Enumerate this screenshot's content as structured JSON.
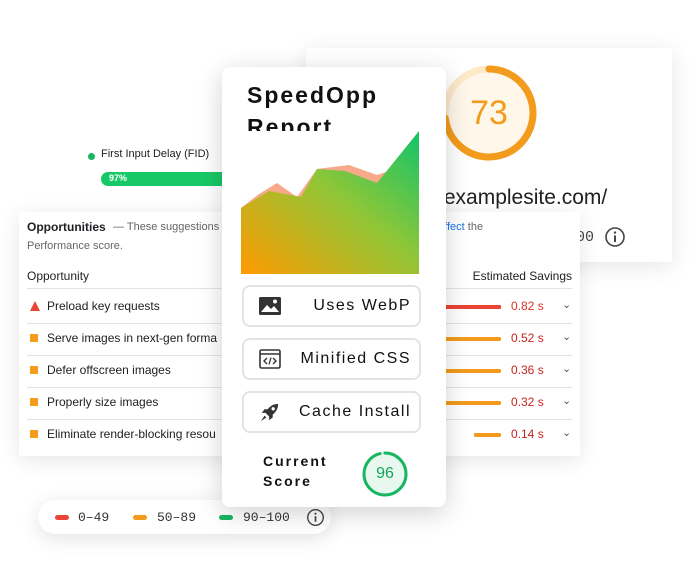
{
  "colors": {
    "fail": "#eb4335",
    "average": "#f29b1c",
    "pass": "#18b663",
    "link": "#1a73e8"
  },
  "score_card": {
    "score": "73",
    "score_fraction": 0.73,
    "url": "w.examplesite.com/",
    "partial_value": "00"
  },
  "fid_metric": {
    "label": "First Input Delay (FID)",
    "bar_value": "97%"
  },
  "opportunities": {
    "title": "Opportunities",
    "description_start": "— These suggestions c",
    "description_end_link": "ly affect",
    "description_end": " the",
    "description_line2": "Performance score.",
    "column_opportunity": "Opportunity",
    "column_savings": "Estimated Savings",
    "items": [
      {
        "label": "Preload key requests",
        "value": "0.82 s",
        "severity": "fail",
        "bar_fraction": 1.0
      },
      {
        "label": "Serve images in next-gen forma",
        "value": "0.52 s",
        "severity": "average",
        "bar_fraction": 0.54
      },
      {
        "label": "Defer offscreen images",
        "value": "0.36 s",
        "severity": "average",
        "bar_fraction": 0.42
      },
      {
        "label": "Properly size images",
        "value": "0.32 s",
        "severity": "average",
        "bar_fraction": 0.38
      },
      {
        "label": "Eliminate render-blocking resou",
        "value": "0.14 s",
        "severity": "average",
        "bar_fraction": 0.18
      }
    ]
  },
  "legend": {
    "ranges": [
      {
        "label": "0–49",
        "color": "#eb4335"
      },
      {
        "label": "50–89",
        "color": "#f29b1c"
      },
      {
        "label": "90–100",
        "color": "#18b663"
      }
    ]
  },
  "report": {
    "title_line1": "SpeedOpp",
    "title_line2": "Report",
    "features": [
      {
        "label": "Uses WebP",
        "icon": "image-icon"
      },
      {
        "label": "Minified CSS",
        "icon": "code-file-icon"
      },
      {
        "label": "Cache Install",
        "icon": "rocket-icon"
      }
    ],
    "current_line1": "Current",
    "current_line2": "Score",
    "current_score": "96",
    "current_fraction": 0.96
  }
}
